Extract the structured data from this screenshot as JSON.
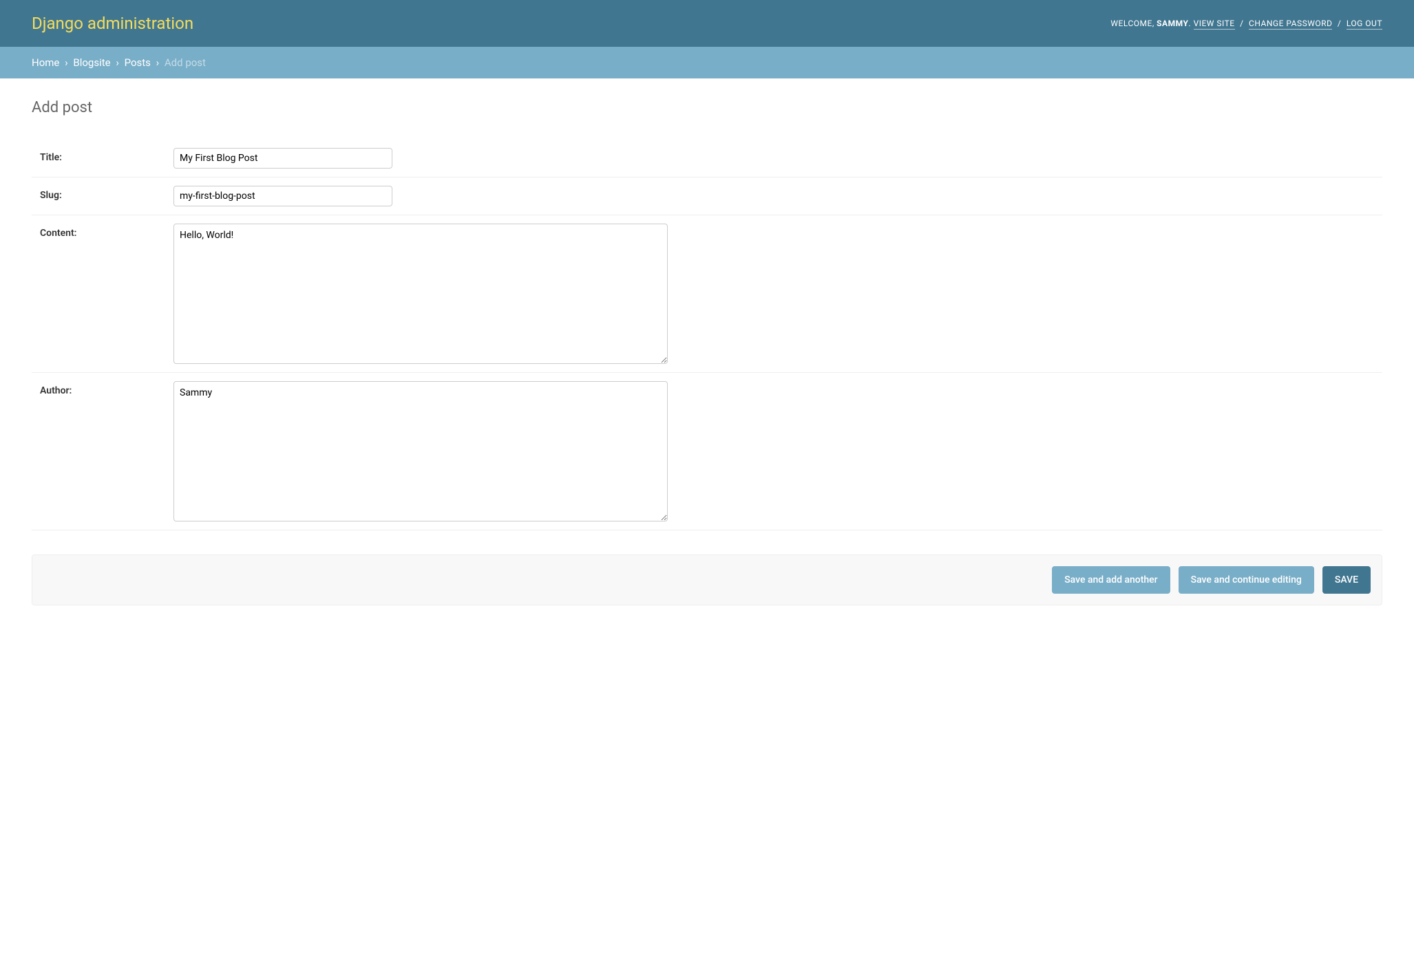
{
  "header": {
    "siteTitle": "Django administration",
    "welcome": "WELCOME,",
    "username": "SAMMY",
    "period": ".",
    "viewSite": "VIEW SITE",
    "changePassword": "CHANGE PASSWORD",
    "logOut": "LOG OUT",
    "separator": "/"
  },
  "breadcrumbs": {
    "home": "Home",
    "app": "Blogsite",
    "model": "Posts",
    "current": "Add post",
    "sep": "›"
  },
  "page": {
    "heading": "Add post"
  },
  "form": {
    "title": {
      "label": "Title:",
      "value": "My First Blog Post"
    },
    "slug": {
      "label": "Slug:",
      "value": "my-first-blog-post"
    },
    "content": {
      "label": "Content:",
      "value": "Hello, World!"
    },
    "author": {
      "label": "Author:",
      "value": "Sammy"
    }
  },
  "buttons": {
    "saveAddAnother": "Save and add another",
    "saveContinue": "Save and continue editing",
    "save": "SAVE"
  }
}
